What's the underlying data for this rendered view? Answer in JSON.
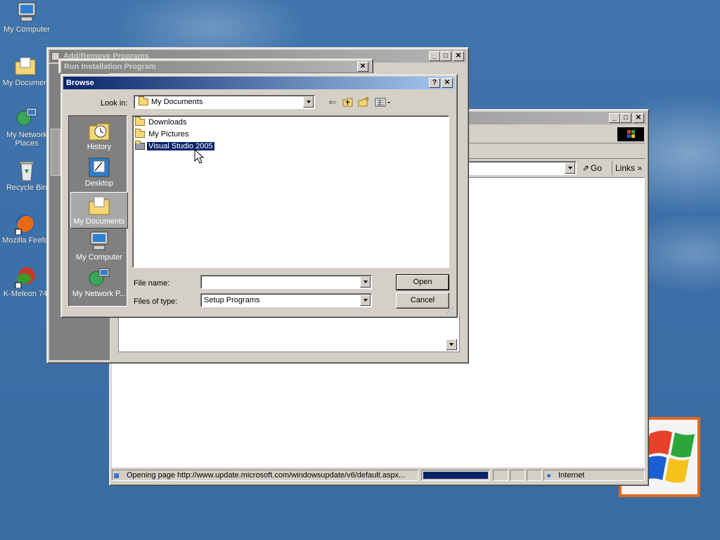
{
  "desktop": {
    "icons": [
      {
        "label": "My Computer"
      },
      {
        "label": "My Documen"
      },
      {
        "label": "My Network Places"
      },
      {
        "label": "Recycle Bin"
      },
      {
        "label": "Mozilla Firefo"
      },
      {
        "label": "K-Meleon 74"
      }
    ]
  },
  "add_remove": {
    "title": "Add/Remove Programs",
    "close_glyph": "✕",
    "min_glyph": "_",
    "max_glyph": "□"
  },
  "run_install": {
    "title": "Run Installation Program",
    "close_glyph": "✕"
  },
  "browse": {
    "title": "Browse",
    "help_glyph": "?",
    "close_glyph": "✕",
    "look_in_label": "Look in:",
    "look_in_value": "My Documents",
    "places": [
      {
        "label": "History"
      },
      {
        "label": "Desktop"
      },
      {
        "label": "My Documents"
      },
      {
        "label": "My Computer"
      },
      {
        "label": "My Network P..."
      }
    ],
    "files": [
      {
        "label": "Downloads"
      },
      {
        "label": "My Pictures"
      },
      {
        "label": "Visual Studio 2005"
      }
    ],
    "file_name_label": "File name:",
    "file_name_value": "",
    "files_of_type_label": "Files of type:",
    "files_of_type_value": "Setup Programs",
    "open_label": "Open",
    "cancel_label": "Cancel"
  },
  "ie": {
    "min_glyph": "_",
    "max_glyph": "□",
    "close_glyph": "✕",
    "go_label": "Go",
    "links_label": "Links",
    "status_text": "Opening page http://www.update.microsoft.com/windowsupdate/v6/default.aspx...",
    "zone_label": "Internet",
    "progress_fraction": 1.0
  }
}
